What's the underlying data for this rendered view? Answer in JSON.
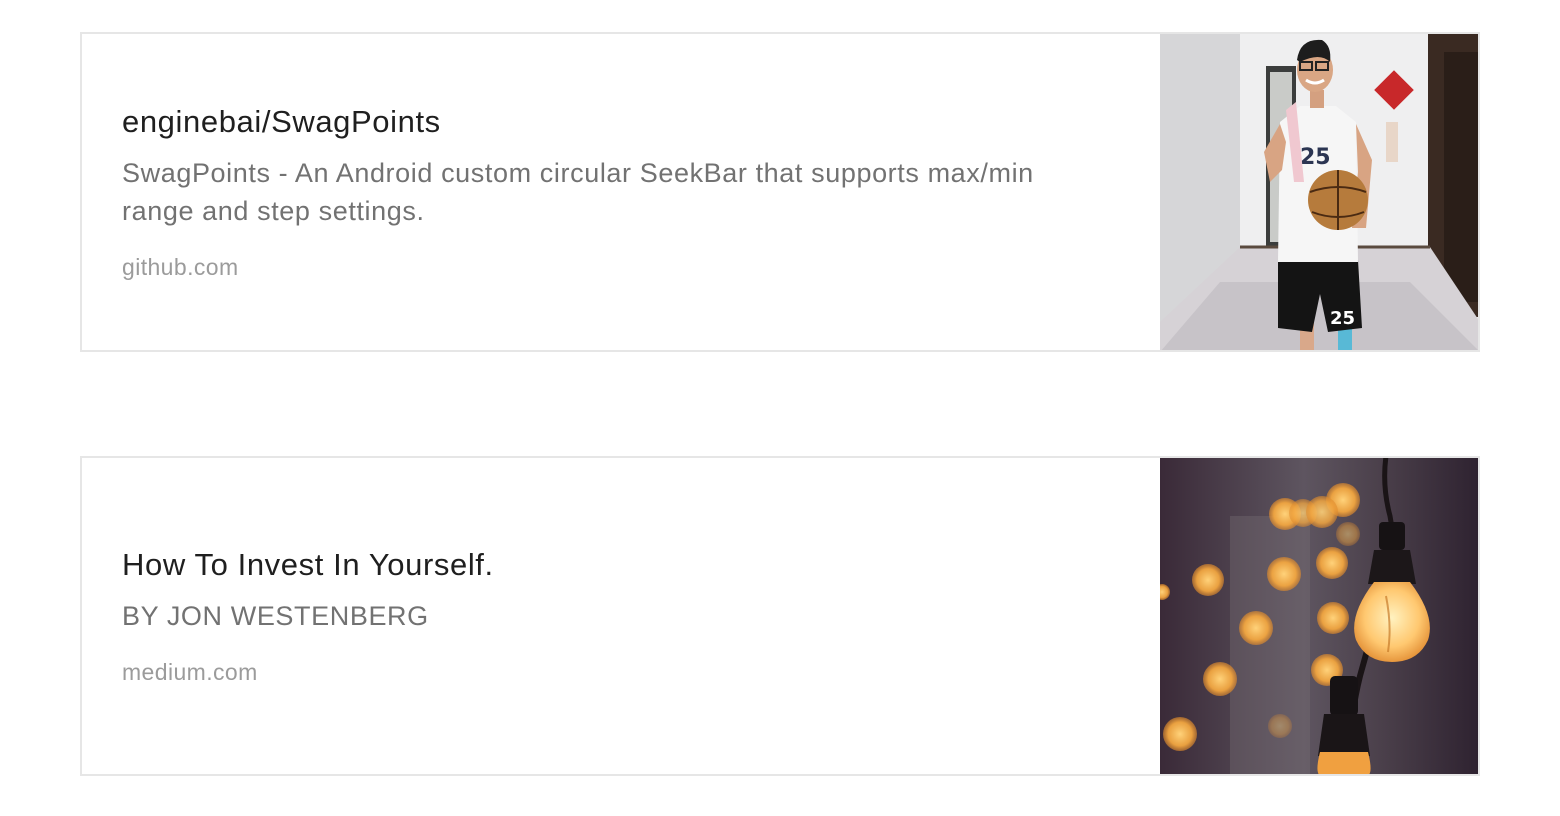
{
  "cards": [
    {
      "title": "enginebai/SwagPoints",
      "description": "SwagPoints - An Android custom circular SeekBar that supports max/min range and step settings.",
      "domain": "github.com",
      "thumbnail": "photo-basketball-player"
    },
    {
      "title": "How To Invest In Yourself.",
      "description": "BY JON WESTENBERG",
      "domain": "medium.com",
      "thumbnail": "photo-lightbulb-bokeh"
    }
  ],
  "colors": {
    "border": "#e6e6e6",
    "title": "#1f1f1f",
    "description": "#727272",
    "domain": "#9b9b9b"
  }
}
